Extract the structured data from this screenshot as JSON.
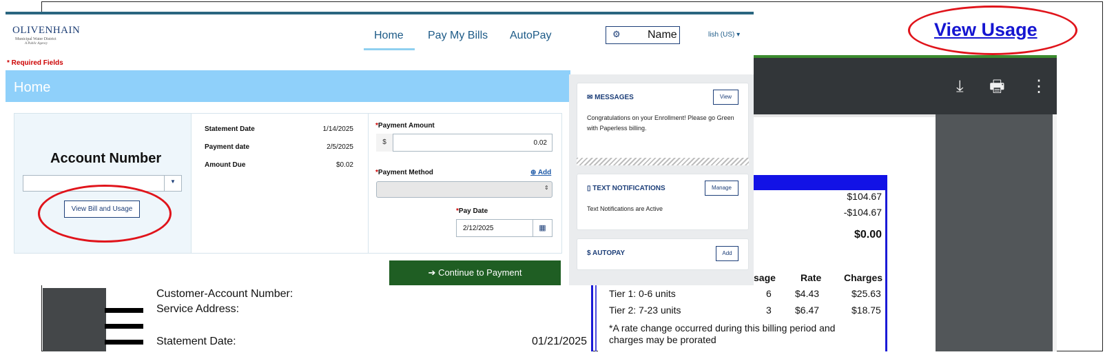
{
  "view_usage_link": "View Usage",
  "pdf_toolbar": {
    "download_icon": "download-icon",
    "print_icon": "printer-icon",
    "more_icon": "more-vert-icon"
  },
  "statement_doc": {
    "customer_account_label": "Customer-Account Number:",
    "service_address_label": "Service Address:",
    "statement_date_label": "Statement Date:",
    "statement_date_value": "01/21/2025",
    "amounts": [
      "$104.67",
      "-$104.67",
      "$0.00"
    ],
    "table_headers": {
      "usage": "sage",
      "rate": "Rate",
      "charges": "Charges"
    },
    "rows": [
      {
        "tier": "Tier 1: 0-6 units",
        "usage": "6",
        "rate": "$4.43",
        "charges": "$25.63"
      },
      {
        "tier": "Tier 2: 7-23 units",
        "usage": "3",
        "rate": "$6.47",
        "charges": "$18.75"
      }
    ],
    "note_line1": "*A rate change occurred during this billing period and",
    "note_line2": "charges may be prorated"
  },
  "logo": {
    "name": "OLIVENHAIN",
    "sub1": "Municipal Water District",
    "sub2": "A Public Agency"
  },
  "nav": {
    "home": "Home",
    "pay_bills": "Pay My Bills",
    "autopay": "AutoPay"
  },
  "user": {
    "name": "Name",
    "language": "lish (US)"
  },
  "required_fields": "* Required Fields",
  "page_title": "Home",
  "account": {
    "title": "Account Number",
    "select_value": "",
    "view_bill_button": "View Bill and Usage"
  },
  "statement": {
    "statement_date_label": "Statement Date",
    "statement_date": "1/14/2025",
    "payment_date_label": "Payment date",
    "payment_date": "2/5/2025",
    "amount_due_label": "Amount Due",
    "amount_due": "$0.02"
  },
  "payment": {
    "amount_label": "Payment Amount",
    "currency": "$",
    "amount_value": "0.02",
    "method_label": "Payment Method",
    "add_label": "Add",
    "method_value": "",
    "pay_date_label": "Pay Date",
    "pay_date_value": "2/12/2025",
    "continue_button": "Continue to Payment"
  },
  "side": {
    "messages_title": "MESSAGES",
    "messages_button": "View",
    "messages_text": "Congratulations on your Enrollment! Please go Green with Paperless billing.",
    "text_notif_title": "TEXT NOTIFICATIONS",
    "text_notif_button": "Manage",
    "text_notif_text": "Text Notifications are Active",
    "autopay_title": "AUTOPAY",
    "autopay_button": "Add"
  },
  "colors": {
    "accent_red": "#e0141b",
    "continue_green": "#1f5e23",
    "home_bar": "#8fd0fa",
    "link_blue": "#1515d1"
  }
}
